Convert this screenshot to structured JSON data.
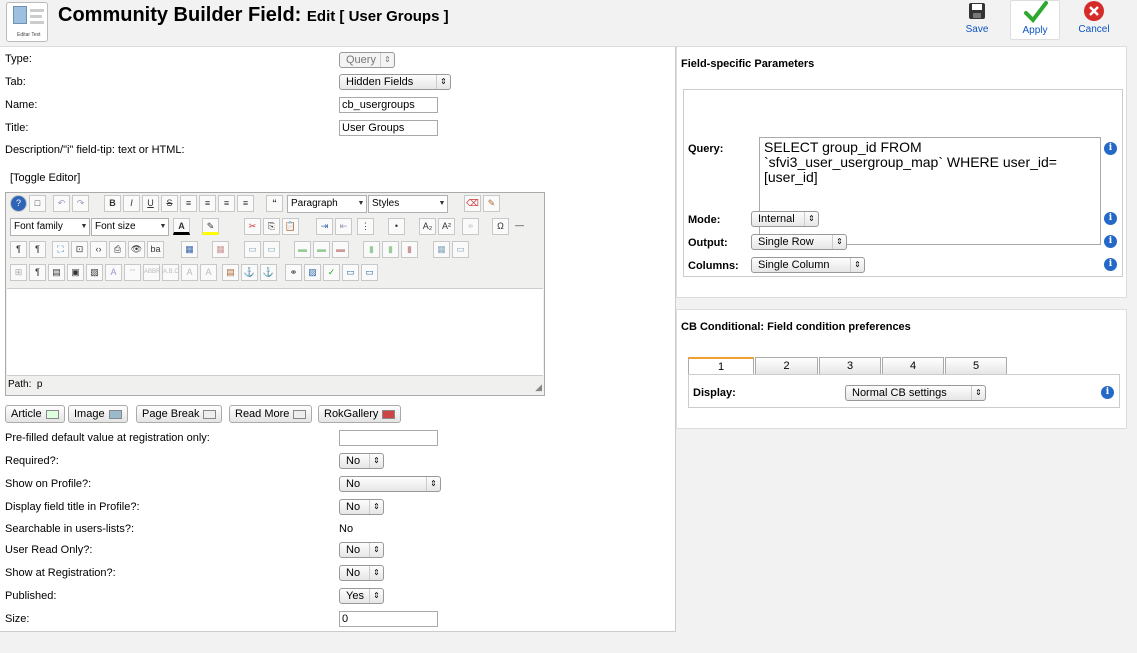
{
  "header": {
    "title": "Community Builder Field:",
    "subtitle": "Edit [ User Groups ]",
    "logo_text": "Editar Text",
    "toolbar": {
      "save_label": "Save",
      "apply_label": "Apply",
      "cancel_label": "Cancel"
    }
  },
  "form": {
    "type": {
      "label": "Type:",
      "value": "Query"
    },
    "tab": {
      "label": "Tab:",
      "value": "Hidden Fields"
    },
    "name": {
      "label": "Name:",
      "value": "cb_usergroups"
    },
    "title": {
      "label": "Title:",
      "value": "User Groups"
    },
    "description": {
      "label": "Description/\"i\" field-tip: text or HTML:"
    },
    "toggle_editor": "[Toggle Editor]",
    "prefilled": {
      "label": "Pre-filled default value at registration only:",
      "value": ""
    },
    "required": {
      "label": "Required?:",
      "value": "No"
    },
    "show_profile": {
      "label": "Show on Profile?:",
      "value": "No"
    },
    "display_title": {
      "label": "Display field title in Profile?:",
      "value": "No"
    },
    "searchable": {
      "label": "Searchable in users-lists?:",
      "value": "No"
    },
    "read_only": {
      "label": "User Read Only?:",
      "value": "No"
    },
    "show_registration": {
      "label": "Show at Registration?:",
      "value": "No"
    },
    "published": {
      "label": "Published:",
      "value": "Yes"
    },
    "size": {
      "label": "Size:",
      "value": "0"
    }
  },
  "editor": {
    "format_select": "Paragraph",
    "styles_select": "Styles",
    "font_family": "Font family",
    "font_size": "Font size",
    "path_label": "Path:",
    "path_value": "p",
    "plugin_buttons": [
      "Article",
      "Image",
      "Page Break",
      "Read More",
      "RokGallery"
    ]
  },
  "params": {
    "title": "Field-specific Parameters",
    "query_label": "Query:",
    "query_value": "SELECT group_id FROM\n`sfvi3_user_usergroup_map` WHERE user_id=\n[user_id]",
    "mode_label": "Mode:",
    "mode_value": "Internal",
    "output_label": "Output:",
    "output_value": "Single Row",
    "columns_label": "Columns:",
    "columns_value": "Single Column"
  },
  "conditional": {
    "title": "CB Conditional: Field condition preferences",
    "tabs": [
      "1",
      "2",
      "3",
      "4",
      "5"
    ],
    "display_label": "Display:",
    "display_value": "Normal CB settings"
  },
  "colors": {
    "accent_link": "#0b55c4",
    "info_icon": "#2468c8",
    "save_icon": "#333333",
    "apply_icon": "#2fa82f",
    "cancel_icon": "#d62b2b"
  }
}
